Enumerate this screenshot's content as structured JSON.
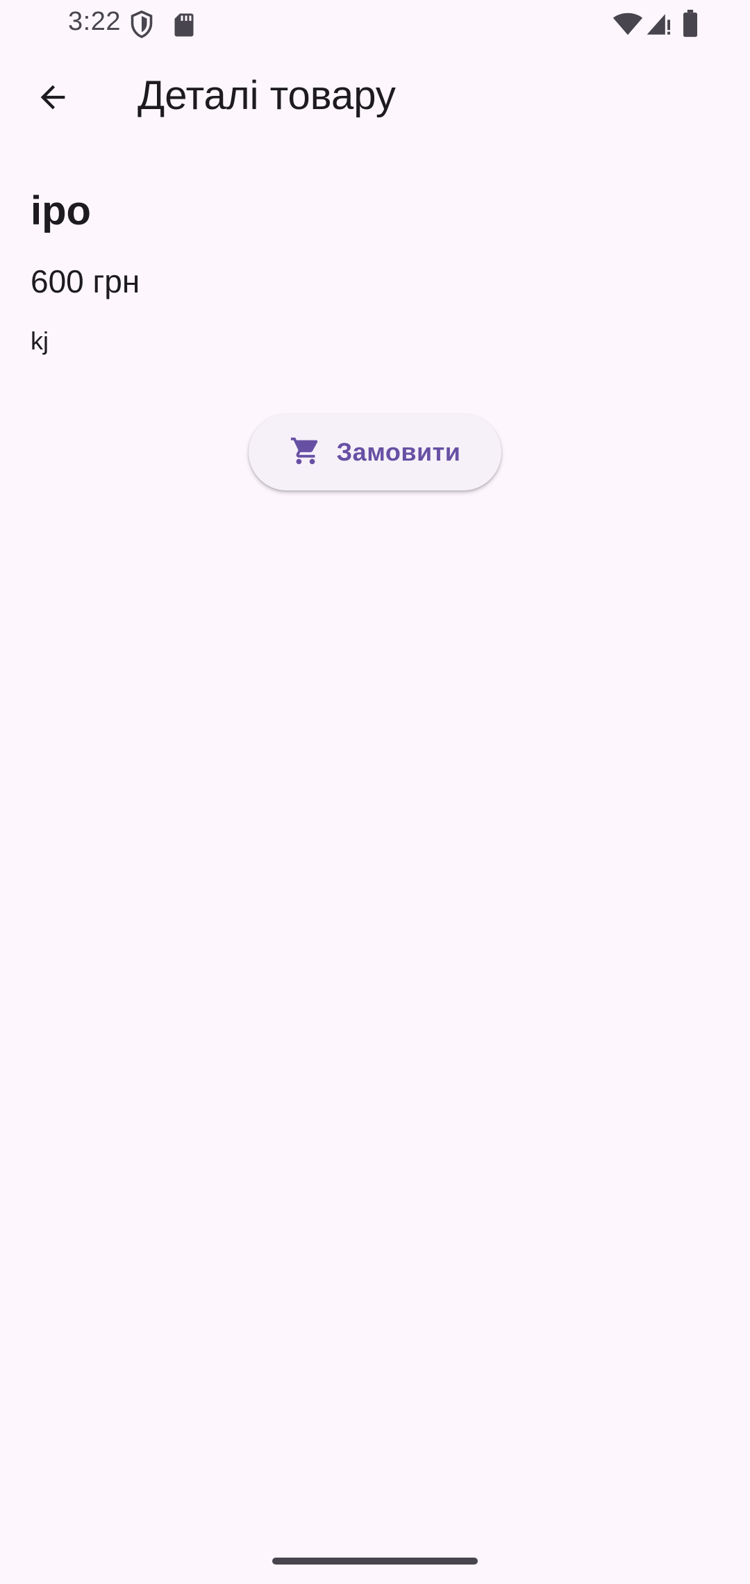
{
  "status_bar": {
    "time": "3:22",
    "icons": [
      "shield-icon",
      "sd-card-icon",
      "wifi-icon",
      "signal-icon",
      "battery-icon"
    ]
  },
  "app_bar": {
    "back_icon": "arrow-back-icon",
    "title": "Деталі товару"
  },
  "product": {
    "name": "ipo",
    "price": "600 грн",
    "description": "kj"
  },
  "order_button": {
    "icon": "cart-icon",
    "label": "Замовити",
    "accent_color": "#6750a4"
  },
  "colors": {
    "background": "#fdf7fd",
    "text": "#1d1b20",
    "accent": "#6750a4"
  }
}
